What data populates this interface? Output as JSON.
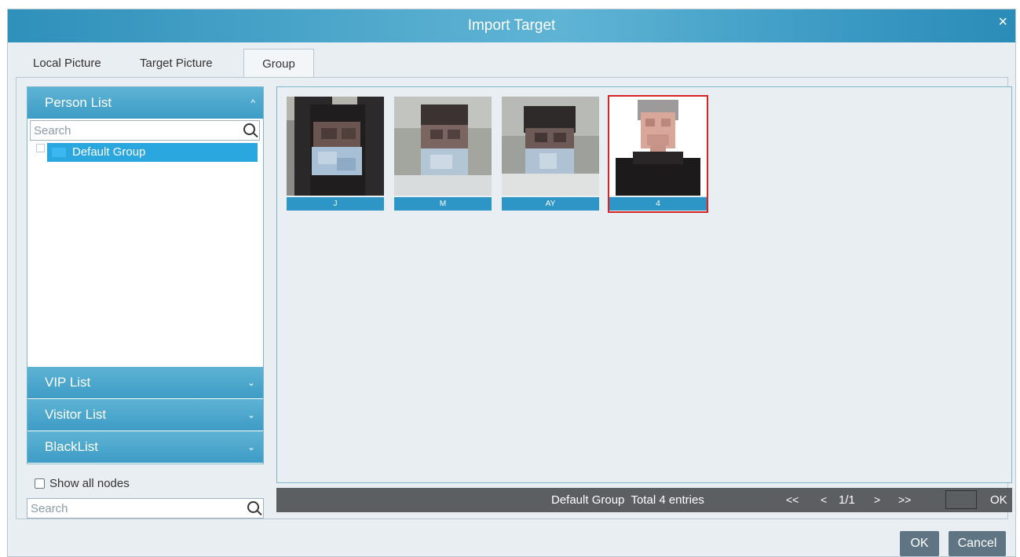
{
  "dialog": {
    "title": "Import Target",
    "close_glyph": "×"
  },
  "tabs": [
    {
      "label": "Local Picture"
    },
    {
      "label": "Target Picture"
    },
    {
      "label": "Group",
      "active": true
    }
  ],
  "sidebar": {
    "sections": [
      {
        "label": "Person List",
        "expanded": true
      },
      {
        "label": "VIP List",
        "expanded": false
      },
      {
        "label": "Visitor List",
        "expanded": false
      },
      {
        "label": "BlackList",
        "expanded": false
      }
    ],
    "search_placeholder": "Search",
    "tree": [
      {
        "label": "Default Group",
        "selected": true
      }
    ],
    "show_all_nodes_label": "Show all nodes",
    "bottom_search_placeholder": "Search"
  },
  "gallery": {
    "items": [
      {
        "caption": "J",
        "selected": false
      },
      {
        "caption": "M",
        "selected": false
      },
      {
        "caption": "AY",
        "selected": false
      },
      {
        "caption": "4",
        "selected": true
      }
    ]
  },
  "statusbar": {
    "group": "Default Group",
    "total": "Total 4 entries",
    "first": "<<",
    "prev": "<",
    "page": "1/1",
    "next": ">",
    "last": ">>",
    "page_input": "",
    "jump_ok": "OK"
  },
  "footer": {
    "ok": "OK",
    "cancel": "Cancel"
  },
  "colors": {
    "accent": "#3d9cc6",
    "selected_border": "#d62525",
    "status_bar": "#5b5f62",
    "button": "#5f7584"
  }
}
